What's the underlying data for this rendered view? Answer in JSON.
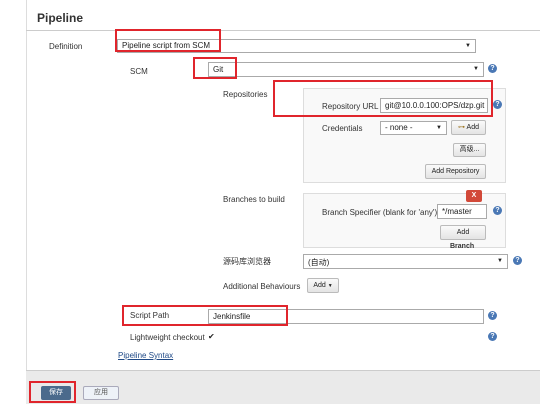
{
  "section_title": "Pipeline",
  "definition": {
    "label": "Definition",
    "value": "Pipeline script from SCM"
  },
  "scm": {
    "label": "SCM",
    "value": "Git"
  },
  "repositories": {
    "label": "Repositories",
    "url_label": "Repository URL",
    "url_value": "git@10.0.0.100:OPS/dzp.git",
    "credentials_label": "Credentials",
    "credentials_value": "- none -",
    "add_label": "Add",
    "advanced_label": "高级...",
    "add_repository_label": "Add Repository"
  },
  "branches": {
    "label": "Branches to build",
    "remove_label": "X",
    "specifier_label": "Branch Specifier (blank for 'any')",
    "specifier_value": "*/master",
    "add_label": "Add",
    "add_branch_label": "Branch"
  },
  "repo_browser": {
    "label": "源码库浏览器",
    "value": "(自动)"
  },
  "behaviours": {
    "label": "Additional Behaviours",
    "add_label": "Add"
  },
  "script_path": {
    "label": "Script Path",
    "value": "Jenkinsfile"
  },
  "lightweight": {
    "label": "Lightweight checkout",
    "checked": true
  },
  "pipeline_syntax_link": "Pipeline Syntax",
  "footer": {
    "save_label": "保存",
    "apply_label": "应用"
  },
  "help_glyph": "?",
  "colors": {
    "highlight_red": "#e0252c",
    "help_blue": "#4a78b5",
    "save_blue": "#4b6a8c",
    "remove_red": "#d24939"
  }
}
